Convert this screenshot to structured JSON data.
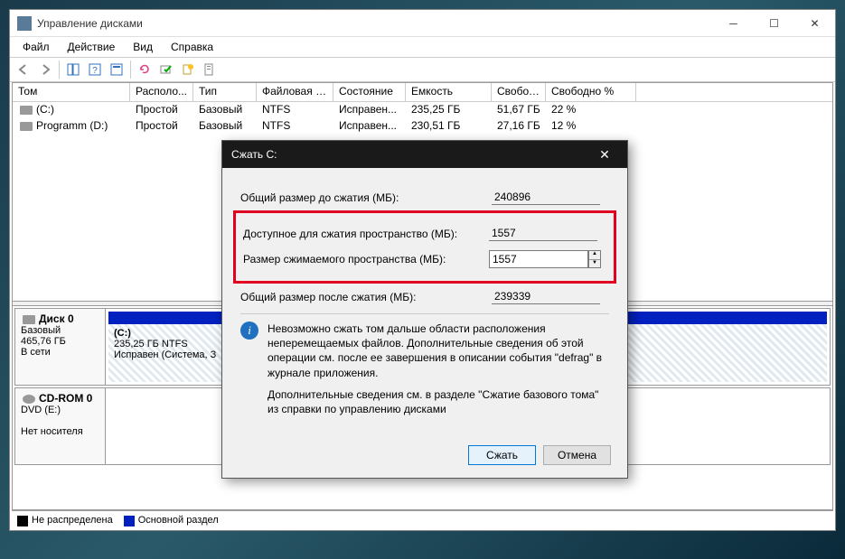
{
  "window": {
    "title": "Управление дисками"
  },
  "menu": {
    "file": "Файл",
    "action": "Действие",
    "view": "Вид",
    "help": "Справка"
  },
  "columns": [
    "Том",
    "Располо...",
    "Тип",
    "Файловая с...",
    "Состояние",
    "Емкость",
    "Свобод...",
    "Свободно %"
  ],
  "volumes": [
    {
      "name": "(C:)",
      "layout": "Простой",
      "type": "Базовый",
      "fs": "NTFS",
      "status": "Исправен...",
      "capacity": "235,25 ГБ",
      "free": "51,67 ГБ",
      "pct": "22 %"
    },
    {
      "name": "Programm (D:)",
      "layout": "Простой",
      "type": "Базовый",
      "fs": "NTFS",
      "status": "Исправен...",
      "capacity": "230,51 ГБ",
      "free": "27,16 ГБ",
      "pct": "12 %"
    }
  ],
  "disks": [
    {
      "label": "Диск 0",
      "type": "Базовый",
      "size": "465,76 ГБ",
      "status": "В сети",
      "partition": {
        "name": "(C:)",
        "line1": "235,25 ГБ NTFS",
        "line2": "Исправен (Система, З"
      }
    },
    {
      "label": "CD-ROM 0",
      "type": "DVD (E:)",
      "size": "",
      "status": "Нет носителя"
    }
  ],
  "legend": {
    "unalloc": "Не распределена",
    "primary": "Основной раздел"
  },
  "dialog": {
    "title": "Сжать C:",
    "total_before_lbl": "Общий размер до сжатия (МБ):",
    "total_before": "240896",
    "available_lbl": "Доступное для сжатия пространство (МБ):",
    "available": "1557",
    "shrink_lbl": "Размер сжимаемого пространства (МБ):",
    "shrink": "1557",
    "total_after_lbl": "Общий размер после сжатия (МБ):",
    "total_after": "239339",
    "info1": "Невозможно сжать том дальше области расположения неперемещаемых файлов. Дополнительные сведения об этой операции см. после ее завершения в описании события \"defrag\" в журнале приложения.",
    "info2": "Дополнительные сведения см. в разделе \"Сжатие базового тома\" из справки по управлению дисками",
    "ok": "Сжать",
    "cancel": "Отмена"
  }
}
